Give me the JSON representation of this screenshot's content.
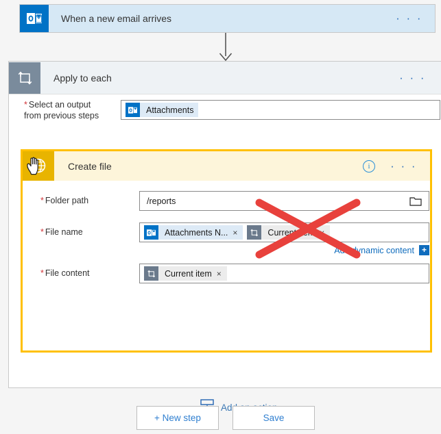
{
  "trigger": {
    "title": "When a new email arrives",
    "icon": "outlook-icon",
    "menu": "· · ·",
    "accent_color": "#0072c6",
    "background_color": "#d6e8f5"
  },
  "connector": {
    "icon": "down-arrow-icon"
  },
  "loop": {
    "title": "Apply to each",
    "icon": "loop-repeat-icon",
    "menu": "· · ·",
    "accent_color": "#7a8b9c",
    "background_color": "#eef2f5",
    "select_output": {
      "label_required": "*",
      "label": "Select an output from previous steps",
      "token": {
        "text": "Attachments",
        "icon": "outlook-icon"
      }
    },
    "add_step_button": {
      "icon": "plus-circle-icon",
      "color": "#3c9ade"
    }
  },
  "create_file": {
    "title": "Create file",
    "icon": "globe-icon",
    "cursor": "hand-pointer-cursor",
    "info_icon": "info-circle-icon",
    "info_label": "i",
    "menu": "· · ·",
    "border_color": "#ffc000",
    "header_background": "#fdf5da",
    "icon_background": "#e8b400",
    "fields": [
      {
        "label_required": "*",
        "label": "Folder path",
        "type": "text",
        "value": "/reports",
        "trailing_icon": "folder-picker-icon"
      },
      {
        "label_required": "*",
        "label": "File name",
        "type": "tokens",
        "tokens": [
          {
            "text": "Attachments N...",
            "icon": "outlook-icon",
            "remove": "×"
          },
          {
            "text": "Current item",
            "icon": "loop-repeat-icon",
            "remove": "×"
          }
        ],
        "add_dynamic_content": {
          "label": "Add dynamic content",
          "icon": "plus-square-icon",
          "plus": "+"
        }
      },
      {
        "label_required": "*",
        "label": "File content",
        "type": "tokens",
        "tokens": [
          {
            "text": "Current item",
            "icon": "loop-repeat-icon",
            "remove": "×"
          }
        ]
      }
    ]
  },
  "annotation": {
    "type": "red-x-cross",
    "color": "#e8413c",
    "target": "Current item token in File name field"
  },
  "add_action": {
    "label": "Add an action",
    "icon": "insert-action-icon",
    "color": "#3c78b4"
  },
  "footer": {
    "new_step_label": "+ New step",
    "save_label": "Save"
  }
}
